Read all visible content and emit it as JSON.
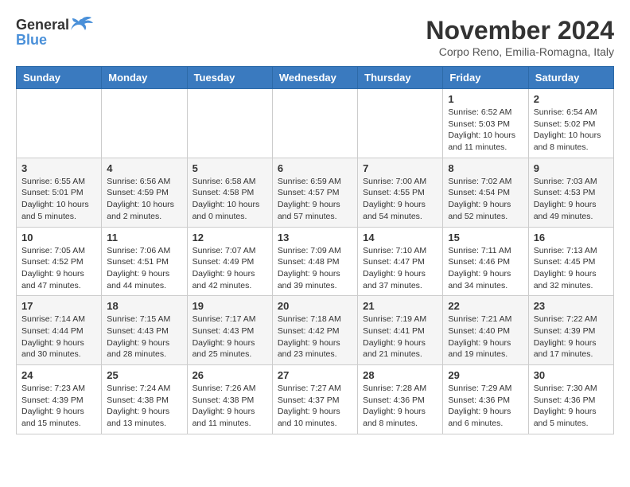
{
  "logo": {
    "general": "General",
    "blue": "Blue"
  },
  "title": "November 2024",
  "location": "Corpo Reno, Emilia-Romagna, Italy",
  "days_of_week": [
    "Sunday",
    "Monday",
    "Tuesday",
    "Wednesday",
    "Thursday",
    "Friday",
    "Saturday"
  ],
  "weeks": [
    [
      {
        "day": "",
        "info": ""
      },
      {
        "day": "",
        "info": ""
      },
      {
        "day": "",
        "info": ""
      },
      {
        "day": "",
        "info": ""
      },
      {
        "day": "",
        "info": ""
      },
      {
        "day": "1",
        "info": "Sunrise: 6:52 AM\nSunset: 5:03 PM\nDaylight: 10 hours and 11 minutes."
      },
      {
        "day": "2",
        "info": "Sunrise: 6:54 AM\nSunset: 5:02 PM\nDaylight: 10 hours and 8 minutes."
      }
    ],
    [
      {
        "day": "3",
        "info": "Sunrise: 6:55 AM\nSunset: 5:01 PM\nDaylight: 10 hours and 5 minutes."
      },
      {
        "day": "4",
        "info": "Sunrise: 6:56 AM\nSunset: 4:59 PM\nDaylight: 10 hours and 2 minutes."
      },
      {
        "day": "5",
        "info": "Sunrise: 6:58 AM\nSunset: 4:58 PM\nDaylight: 10 hours and 0 minutes."
      },
      {
        "day": "6",
        "info": "Sunrise: 6:59 AM\nSunset: 4:57 PM\nDaylight: 9 hours and 57 minutes."
      },
      {
        "day": "7",
        "info": "Sunrise: 7:00 AM\nSunset: 4:55 PM\nDaylight: 9 hours and 54 minutes."
      },
      {
        "day": "8",
        "info": "Sunrise: 7:02 AM\nSunset: 4:54 PM\nDaylight: 9 hours and 52 minutes."
      },
      {
        "day": "9",
        "info": "Sunrise: 7:03 AM\nSunset: 4:53 PM\nDaylight: 9 hours and 49 minutes."
      }
    ],
    [
      {
        "day": "10",
        "info": "Sunrise: 7:05 AM\nSunset: 4:52 PM\nDaylight: 9 hours and 47 minutes."
      },
      {
        "day": "11",
        "info": "Sunrise: 7:06 AM\nSunset: 4:51 PM\nDaylight: 9 hours and 44 minutes."
      },
      {
        "day": "12",
        "info": "Sunrise: 7:07 AM\nSunset: 4:49 PM\nDaylight: 9 hours and 42 minutes."
      },
      {
        "day": "13",
        "info": "Sunrise: 7:09 AM\nSunset: 4:48 PM\nDaylight: 9 hours and 39 minutes."
      },
      {
        "day": "14",
        "info": "Sunrise: 7:10 AM\nSunset: 4:47 PM\nDaylight: 9 hours and 37 minutes."
      },
      {
        "day": "15",
        "info": "Sunrise: 7:11 AM\nSunset: 4:46 PM\nDaylight: 9 hours and 34 minutes."
      },
      {
        "day": "16",
        "info": "Sunrise: 7:13 AM\nSunset: 4:45 PM\nDaylight: 9 hours and 32 minutes."
      }
    ],
    [
      {
        "day": "17",
        "info": "Sunrise: 7:14 AM\nSunset: 4:44 PM\nDaylight: 9 hours and 30 minutes."
      },
      {
        "day": "18",
        "info": "Sunrise: 7:15 AM\nSunset: 4:43 PM\nDaylight: 9 hours and 28 minutes."
      },
      {
        "day": "19",
        "info": "Sunrise: 7:17 AM\nSunset: 4:43 PM\nDaylight: 9 hours and 25 minutes."
      },
      {
        "day": "20",
        "info": "Sunrise: 7:18 AM\nSunset: 4:42 PM\nDaylight: 9 hours and 23 minutes."
      },
      {
        "day": "21",
        "info": "Sunrise: 7:19 AM\nSunset: 4:41 PM\nDaylight: 9 hours and 21 minutes."
      },
      {
        "day": "22",
        "info": "Sunrise: 7:21 AM\nSunset: 4:40 PM\nDaylight: 9 hours and 19 minutes."
      },
      {
        "day": "23",
        "info": "Sunrise: 7:22 AM\nSunset: 4:39 PM\nDaylight: 9 hours and 17 minutes."
      }
    ],
    [
      {
        "day": "24",
        "info": "Sunrise: 7:23 AM\nSunset: 4:39 PM\nDaylight: 9 hours and 15 minutes."
      },
      {
        "day": "25",
        "info": "Sunrise: 7:24 AM\nSunset: 4:38 PM\nDaylight: 9 hours and 13 minutes."
      },
      {
        "day": "26",
        "info": "Sunrise: 7:26 AM\nSunset: 4:38 PM\nDaylight: 9 hours and 11 minutes."
      },
      {
        "day": "27",
        "info": "Sunrise: 7:27 AM\nSunset: 4:37 PM\nDaylight: 9 hours and 10 minutes."
      },
      {
        "day": "28",
        "info": "Sunrise: 7:28 AM\nSunset: 4:36 PM\nDaylight: 9 hours and 8 minutes."
      },
      {
        "day": "29",
        "info": "Sunrise: 7:29 AM\nSunset: 4:36 PM\nDaylight: 9 hours and 6 minutes."
      },
      {
        "day": "30",
        "info": "Sunrise: 7:30 AM\nSunset: 4:36 PM\nDaylight: 9 hours and 5 minutes."
      }
    ]
  ]
}
